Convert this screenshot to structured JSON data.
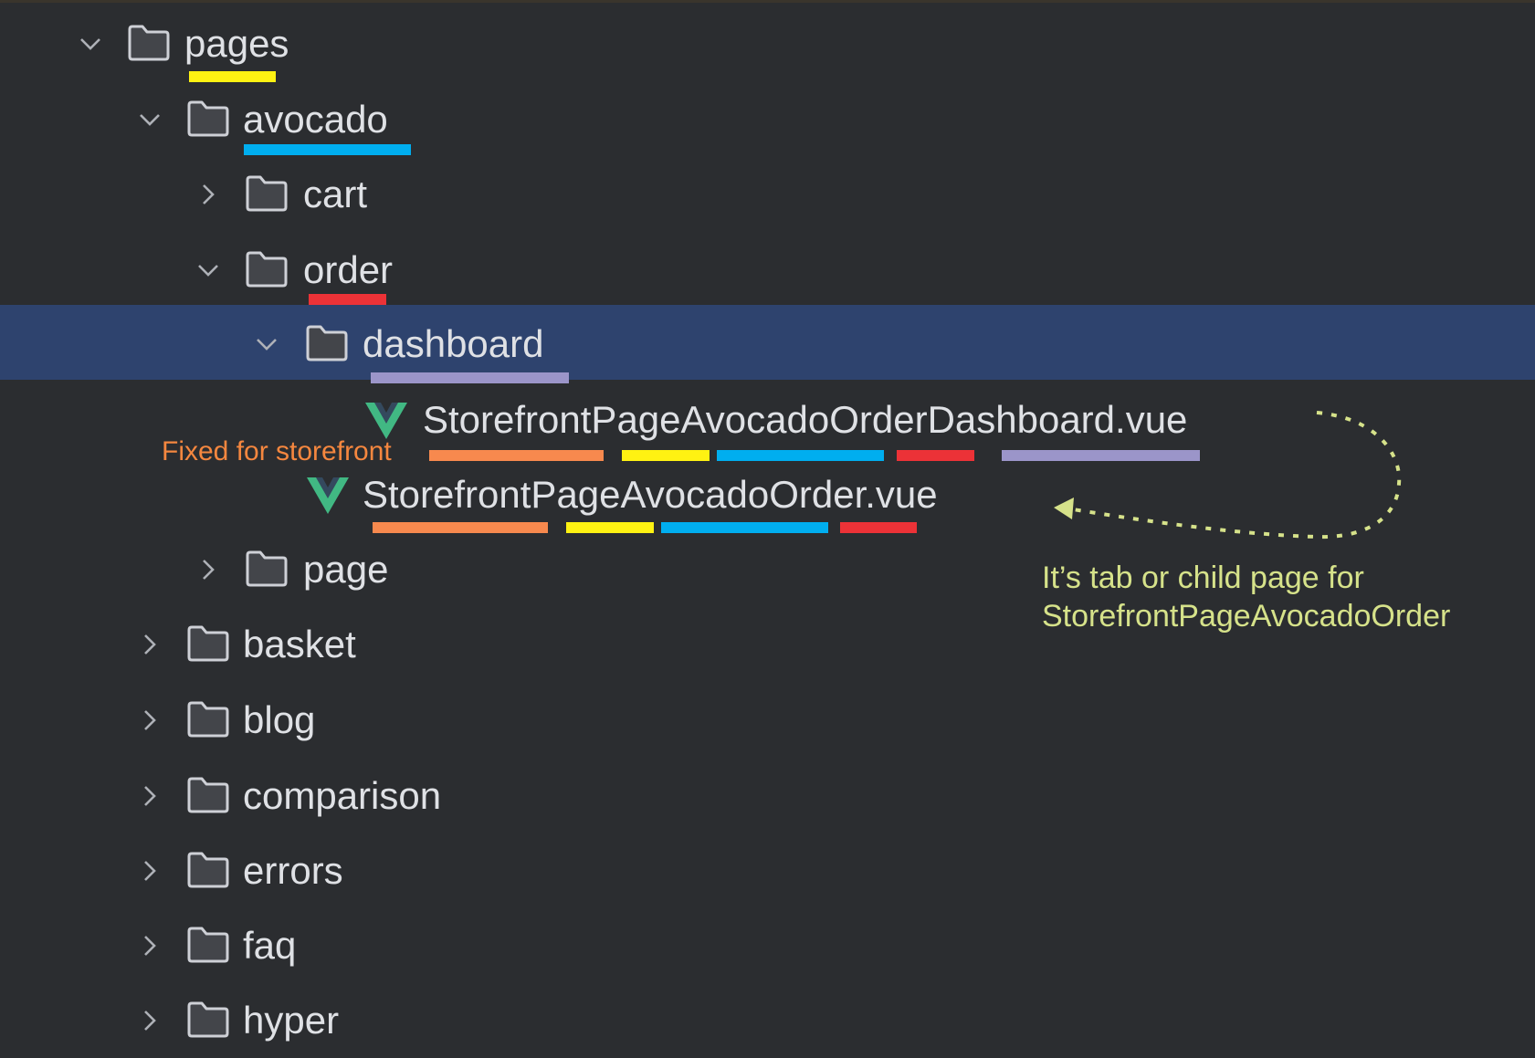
{
  "tree": {
    "items": [
      {
        "label": "pages",
        "type": "folder",
        "expanded": true
      },
      {
        "label": "avocado",
        "type": "folder",
        "expanded": true
      },
      {
        "label": "cart",
        "type": "folder",
        "expanded": false
      },
      {
        "label": "order",
        "type": "folder",
        "expanded": true
      },
      {
        "label": "dashboard",
        "type": "folder",
        "expanded": true,
        "selected": true
      },
      {
        "label": "StorefrontPageAvocadoOrderDashboard.vue",
        "type": "vue-file"
      },
      {
        "label": "StorefrontPageAvocadoOrder.vue",
        "type": "vue-file"
      },
      {
        "label": "page",
        "type": "folder",
        "expanded": false
      },
      {
        "label": "basket",
        "type": "folder",
        "expanded": false
      },
      {
        "label": "blog",
        "type": "folder",
        "expanded": false
      },
      {
        "label": "comparison",
        "type": "folder",
        "expanded": false
      },
      {
        "label": "errors",
        "type": "folder",
        "expanded": false
      },
      {
        "label": "faq",
        "type": "folder",
        "expanded": false
      },
      {
        "label": "hyper",
        "type": "folder",
        "expanded": false
      }
    ]
  },
  "annotations": {
    "fixed_prefix": "Fixed for storefront",
    "child_note_line1": "It’s tab or child page for",
    "child_note_line2": "StorefrontPageAvocadoOrder"
  },
  "colors": {
    "background": "#2b2d30",
    "selection": "#2e436e",
    "pages": "#fff212",
    "avocado": "#00aeef",
    "order": "#ec3237",
    "dashboard": "#9b95c9",
    "storefront": "#f7894e",
    "note": "#d6e28a"
  }
}
